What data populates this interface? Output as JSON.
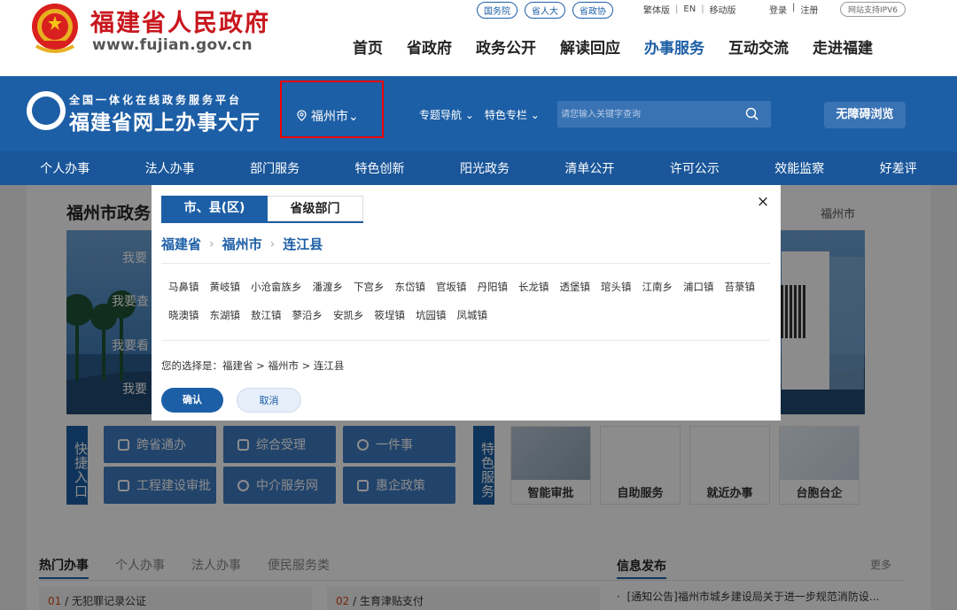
{
  "header": {
    "site_title": "福建省人民政府",
    "site_url": "www.fujian.gov.cn",
    "top_links": [
      "国务院",
      "省人大",
      "省政协"
    ],
    "util_links": [
      "繁体版",
      "EN",
      "移动版"
    ],
    "auth_links": [
      "登录",
      "注册"
    ],
    "ipv6": "网站支持IPV6",
    "nav": [
      {
        "label": "首页",
        "active": false
      },
      {
        "label": "省政府",
        "active": false
      },
      {
        "label": "政务公开",
        "active": false
      },
      {
        "label": "解读回应",
        "active": false
      },
      {
        "label": "办事服务",
        "active": true
      },
      {
        "label": "互动交流",
        "active": false
      },
      {
        "label": "走进福建",
        "active": false
      }
    ]
  },
  "hall": {
    "subtitle": "全国一体化在线政务服务平台",
    "title": "福建省网上办事大厅",
    "city": "福州市",
    "menu": [
      "专题导航",
      "特色专栏"
    ],
    "search_placeholder": "请您输入关键字查询",
    "accessibility": "无障碍浏览"
  },
  "sub_nav": [
    "个人办事",
    "法人办事",
    "部门服务",
    "特色创新",
    "阳光政务",
    "清单公开",
    "许可公示",
    "效能监察",
    "好差评"
  ],
  "content": {
    "title": "福州市政务",
    "crumb": "福州市",
    "banner_items": [
      "我要",
      "我要查",
      "我要看",
      "我要"
    ],
    "quick_label": "快捷入口",
    "quick_buttons": [
      "跨省通办",
      "综合受理",
      "一件事",
      "工程建设审批",
      "中介服务网",
      "惠企政策"
    ],
    "feature_label": "特色服务",
    "feature_cards": [
      "智能审批",
      "自助服务",
      "就近办事",
      "台胞台企"
    ],
    "bottom_tabs": [
      "热门办事",
      "个人办事",
      "法人办事",
      "便民服务类"
    ],
    "info_title": "信息发布",
    "info_more": "更多",
    "hot_items": [
      {
        "no": "01",
        "label": "无犯罪记录公证"
      },
      {
        "no": "02",
        "label": "生育津贴支付"
      }
    ],
    "info_item": "[通知公告]福州市城乡建设局关于进一步规范消防设..."
  },
  "modal": {
    "tabs": [
      "市、县(区)",
      "省级部门"
    ],
    "close": "×",
    "crumb": [
      "福建省",
      "福州市",
      "连江县"
    ],
    "towns": [
      "马鼻镇",
      "黄岐镇",
      "小沧畲族乡",
      "潘渡乡",
      "下宫乡",
      "东岱镇",
      "官坂镇",
      "丹阳镇",
      "长龙镇",
      "透堡镇",
      "琯头镇",
      "江南乡",
      "浦口镇",
      "苔菉镇",
      "晓澳镇",
      "东湖镇",
      "敖江镇",
      "蓼沿乡",
      "安凯乡",
      "筱埕镇",
      "坑园镇",
      "凤城镇"
    ],
    "choice_prefix": "您的选择是：",
    "choice_path": "福建省 > 福州市 > 连江县",
    "confirm": "确认",
    "cancel": "取消"
  },
  "colors": {
    "primary": "#1d5fa6",
    "brand_red": "#c8161d",
    "highlight_border": "#ee0000"
  }
}
